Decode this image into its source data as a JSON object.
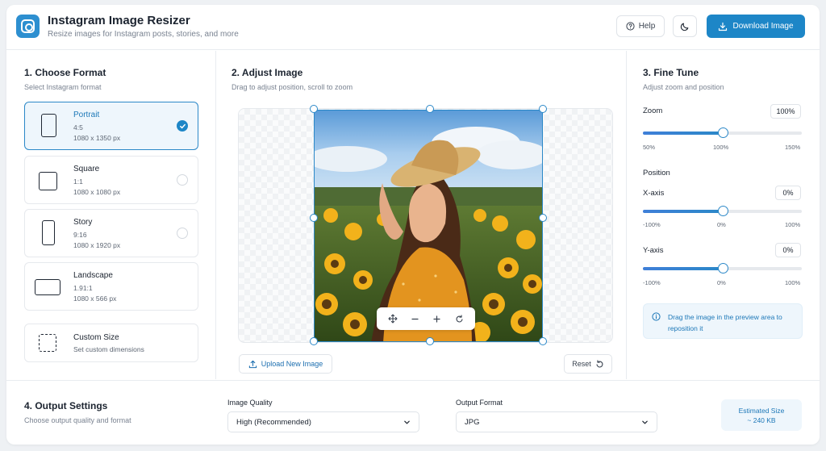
{
  "header": {
    "title": "Instagram Image Resizer",
    "subtitle": "Resize images for Instagram posts, stories, and more",
    "help_label": "Help",
    "download_label": "Download Image",
    "accent_color": "#1d86c7"
  },
  "format": {
    "title": "1. Choose Format",
    "subtitle": "Select Instagram format",
    "selected": "Portrait",
    "options": [
      {
        "name": "Portrait",
        "ratio": "4:5",
        "dims": "1080 x 1350 px"
      },
      {
        "name": "Square",
        "ratio": "1:1",
        "dims": "1080 x 1080 px"
      },
      {
        "name": "Story",
        "ratio": "9:16",
        "dims": "1080 x 1920 px"
      },
      {
        "name": "Landscape",
        "ratio": "1.91:1",
        "dims": "1080 x 566 px"
      }
    ],
    "custom": {
      "name": "Custom Size",
      "desc": "Set custom dimensions"
    }
  },
  "adjust": {
    "title": "2. Adjust Image",
    "subtitle": "Drag to adjust position, scroll to zoom",
    "upload_label": "Upload New Image",
    "reset_label": "Reset",
    "tool_icons": [
      "move-icon",
      "zoom-out-icon",
      "zoom-in-icon",
      "rotate-icon"
    ]
  },
  "finetune": {
    "title": "3. Fine Tune",
    "subtitle": "Adjust zoom and position",
    "zoom": {
      "label": "Zoom",
      "value": "100%",
      "min_label": "50%",
      "mid_label": "100%",
      "max_label": "150%",
      "position": 0.5
    },
    "position_label": "Position",
    "x_axis": {
      "label": "X-axis",
      "value": "0%",
      "min_label": "-100%",
      "mid_label": "0%",
      "max_label": "100%",
      "position": 0.5
    },
    "y_axis": {
      "label": "Y-axis",
      "value": "0%",
      "min_label": "-100%",
      "mid_label": "0%",
      "max_label": "100%",
      "position": 0.5
    },
    "info": "Drag the image in the preview area to reposition it"
  },
  "output": {
    "title": "4. Output Settings",
    "subtitle": "Choose output quality and format",
    "quality_label": "Image Quality",
    "quality_value": "High (Recommended)",
    "format_label": "Output Format",
    "format_value": "JPG",
    "estimate_label": "Estimated Size",
    "estimate_value": "~ 240 KB"
  }
}
